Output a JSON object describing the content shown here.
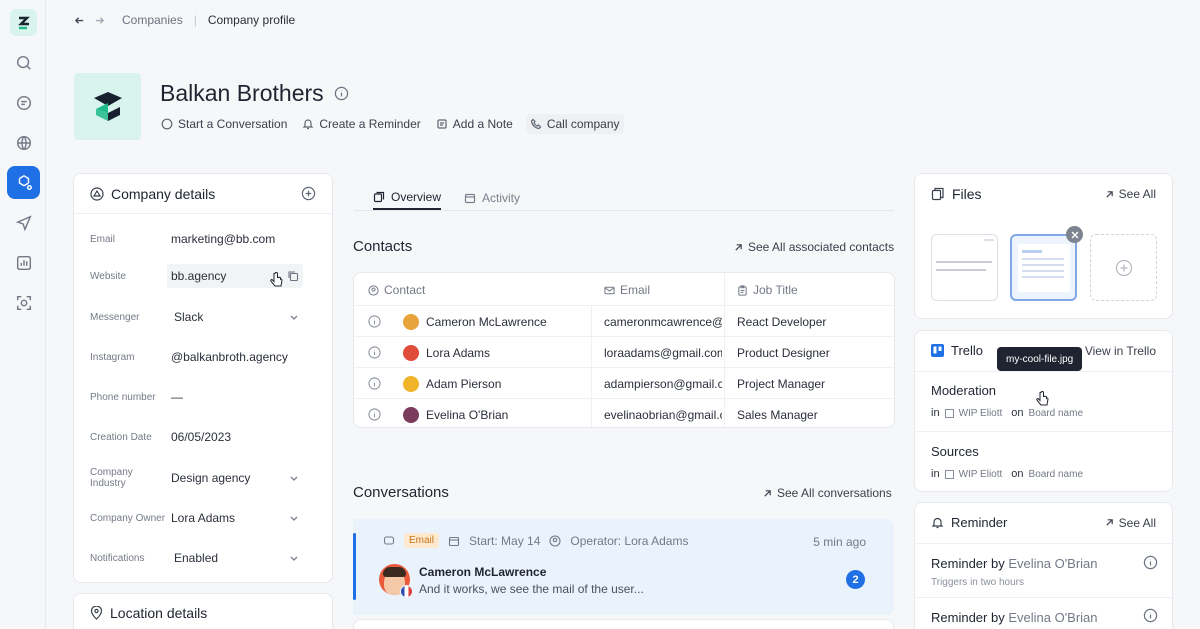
{
  "breadcrumb": {
    "items": [
      "Companies",
      "Company profile"
    ]
  },
  "company": {
    "name": "Balkan Brothers",
    "actions": [
      "Start a Conversation",
      "Create a Reminder",
      "Add a Note",
      "Call company"
    ]
  },
  "details": {
    "title": "Company details",
    "rows": [
      {
        "label": "Email",
        "value": "marketing@bb.com"
      },
      {
        "label": "Website",
        "value": "bb.agency"
      },
      {
        "label": "Messenger",
        "value": "Slack"
      },
      {
        "label": "Instagram",
        "value": "@balkanbroth.agency"
      },
      {
        "label": "Phone number",
        "value": "—"
      },
      {
        "label": "Creation Date",
        "value": "06/05/2023"
      },
      {
        "label": "Company Industry",
        "value": "Design agency"
      },
      {
        "label": "Company Owner",
        "value": "Lora Adams"
      },
      {
        "label": "Notifications",
        "value": "Enabled"
      }
    ]
  },
  "location": {
    "title": "Location details"
  },
  "tabs": [
    "Overview",
    "Activity"
  ],
  "contacts": {
    "title": "Contacts",
    "see_all": "See All associated contacts",
    "headers": [
      "Contact",
      "Email",
      "Job Title"
    ],
    "rows": [
      {
        "name": "Cameron McLawrence",
        "email": "cameronmcawrence@gmail.com",
        "job": "React Developer",
        "avatar": "#e8a33b"
      },
      {
        "name": "Lora Adams",
        "email": "loraadams@gmail.com",
        "job": "Product Designer",
        "avatar": "#e04b3a"
      },
      {
        "name": "Adam Pierson",
        "email": "adampierson@gmail.com",
        "job": "Project Manager",
        "avatar": "#f0b429"
      },
      {
        "name": "Evelina O'Brian",
        "email": "evelinaobrian@gmail.com",
        "job": "Sales Manager",
        "avatar": "#7a3b5c"
      }
    ]
  },
  "conversations": {
    "title": "Conversations",
    "see_all": "See All conversations",
    "item": {
      "channel": "Email",
      "start": "Start: May 14",
      "operator": "Operator: Lora Adams",
      "time": "5 min ago",
      "name": "Cameron McLawrence",
      "message": "And it works, we see the mail of the user...",
      "unread": "2"
    }
  },
  "files": {
    "title": "Files",
    "see_all": "See All"
  },
  "trello": {
    "title": "Trello",
    "view_link": "View in Trello",
    "tooltip": "my-cool-file.jpg",
    "items": [
      {
        "title": "Moderation",
        "in": "in",
        "list": "WIP Eliott",
        "on": "on",
        "board": "Board name"
      },
      {
        "title": "Sources",
        "in": "in",
        "list": "WIP Eliott",
        "on": "on",
        "board": "Board name"
      }
    ]
  },
  "reminder": {
    "title": "Reminder",
    "see_all": "See All",
    "items": [
      {
        "prefix": "Reminder by",
        "person": "Evelina O'Brian",
        "sub": "Triggers in two hours"
      },
      {
        "prefix": "Reminder by",
        "person": "Evelina O'Brian",
        "sub": ""
      }
    ]
  },
  "colors": {
    "accent": "#1f6fe5",
    "brand_bg": "#d9f4ec",
    "selected_row": "#eaf2fc"
  }
}
